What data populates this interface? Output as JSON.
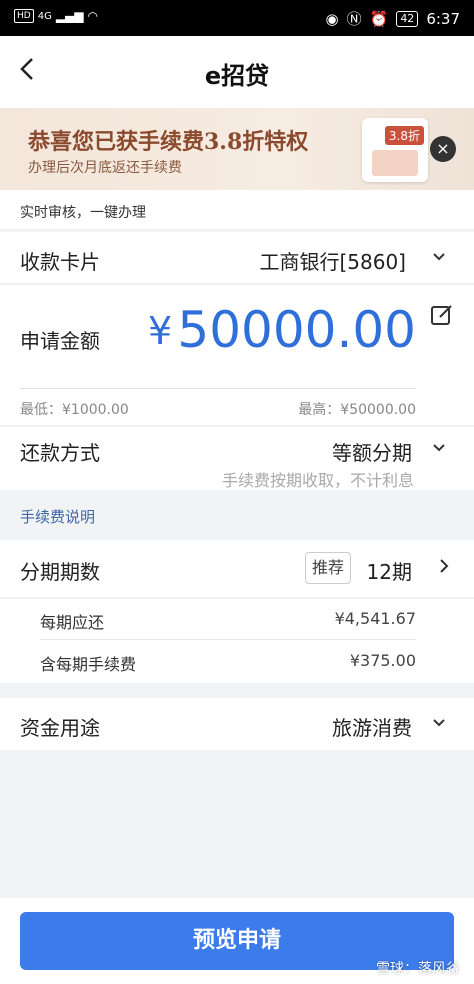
{
  "status": {
    "hd": "HD",
    "network": "4G",
    "battery": "42",
    "time": "6:37"
  },
  "nav": {
    "title": "e招贷",
    "back_icon": "chevron-left-icon"
  },
  "promo": {
    "title": "恭喜您已获手续费3.8折特权",
    "subtitle": "办理后次月底返还手续费",
    "badge": "3.8折",
    "close_icon": "close-icon"
  },
  "notice": "实时审核，一键办理",
  "card": {
    "label": "收款卡片",
    "value": "工商银行[5860]"
  },
  "amount": {
    "label": "申请金额",
    "currency": "¥",
    "value": "50000.00",
    "min": "最低：¥1000.00",
    "max": "最高：¥50000.00",
    "edit_icon": "edit-icon"
  },
  "repay": {
    "label": "还款方式",
    "value": "等额分期",
    "hint": "手续费按期收取，不计利息"
  },
  "fee_link": "手续费说明",
  "period": {
    "label": "分期期数",
    "tag": "推荐",
    "value": "12期"
  },
  "details": [
    {
      "label": "每期应还",
      "value": "¥4,541.67"
    },
    {
      "label": "含每期手续费",
      "value": "¥375.00"
    }
  ],
  "purpose": {
    "label": "资金用途",
    "value": "旅游消费"
  },
  "submit": "预览申请",
  "watermark": "雪球：落风谷",
  "colors": {
    "accent": "#2f6fd9",
    "button": "#3b7bea",
    "promo_text": "#8b4a2e"
  }
}
